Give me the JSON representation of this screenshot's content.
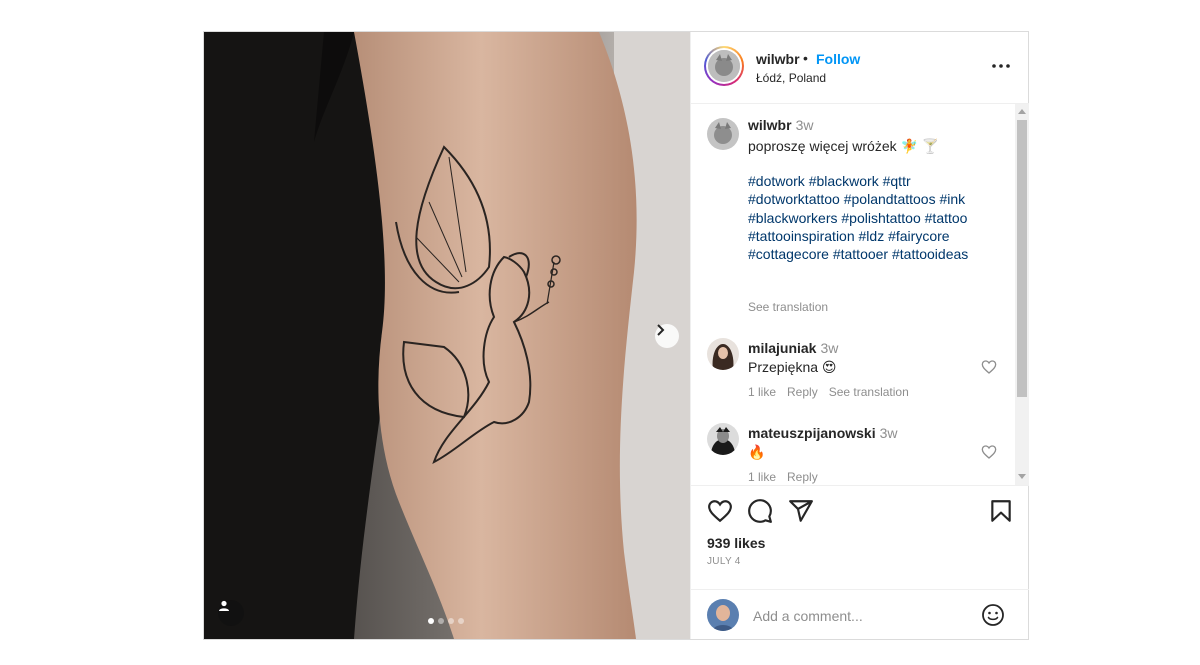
{
  "post": {
    "author": "wilwbr",
    "separator": "•",
    "follow_label": "Follow",
    "location": "Łódź, Poland",
    "more_icon": "more-horizontal-icon"
  },
  "media": {
    "description_icon": "tattoo-photo",
    "current_slide": 1,
    "total_slides": 4,
    "next_icon": "chevron-right-icon",
    "user_tag_icon": "user-tag-icon"
  },
  "caption": {
    "user": "wilwbr",
    "time": "3w",
    "text": "poproszę więcej wróżek 🧚 🍸",
    "hashtags_lines": [
      "#dotwork #blackwork #qttr",
      "#dotworktattoo #polandtattoos #ink",
      "#blackworkers #polishtattoo #tattoo",
      "#tattooinspiration #ldz #fairycore",
      "#cottagecore #tattooer #tattooideas"
    ],
    "see_translation": "See translation"
  },
  "comments": [
    {
      "user": "milajuniak",
      "time": "3w",
      "text": "Przepiękna 😍",
      "likes": "1 like",
      "reply": "Reply",
      "translate": "See translation"
    },
    {
      "user": "mateuszpijanowski",
      "time": "3w",
      "text": "🔥",
      "likes": "1 like",
      "reply": "Reply"
    }
  ],
  "actions": {
    "like_icon": "heart-icon",
    "comment_icon": "comment-icon",
    "share_icon": "send-icon",
    "save_icon": "bookmark-icon",
    "likes_text": "939 likes",
    "date": "JULY 4"
  },
  "add_comment": {
    "placeholder": "Add a comment...",
    "emoji_icon": "emoji-icon"
  },
  "colors": {
    "accent": "#0095f6",
    "hashtag": "#00376b",
    "muted": "#8e8e8e",
    "text": "#262626"
  }
}
